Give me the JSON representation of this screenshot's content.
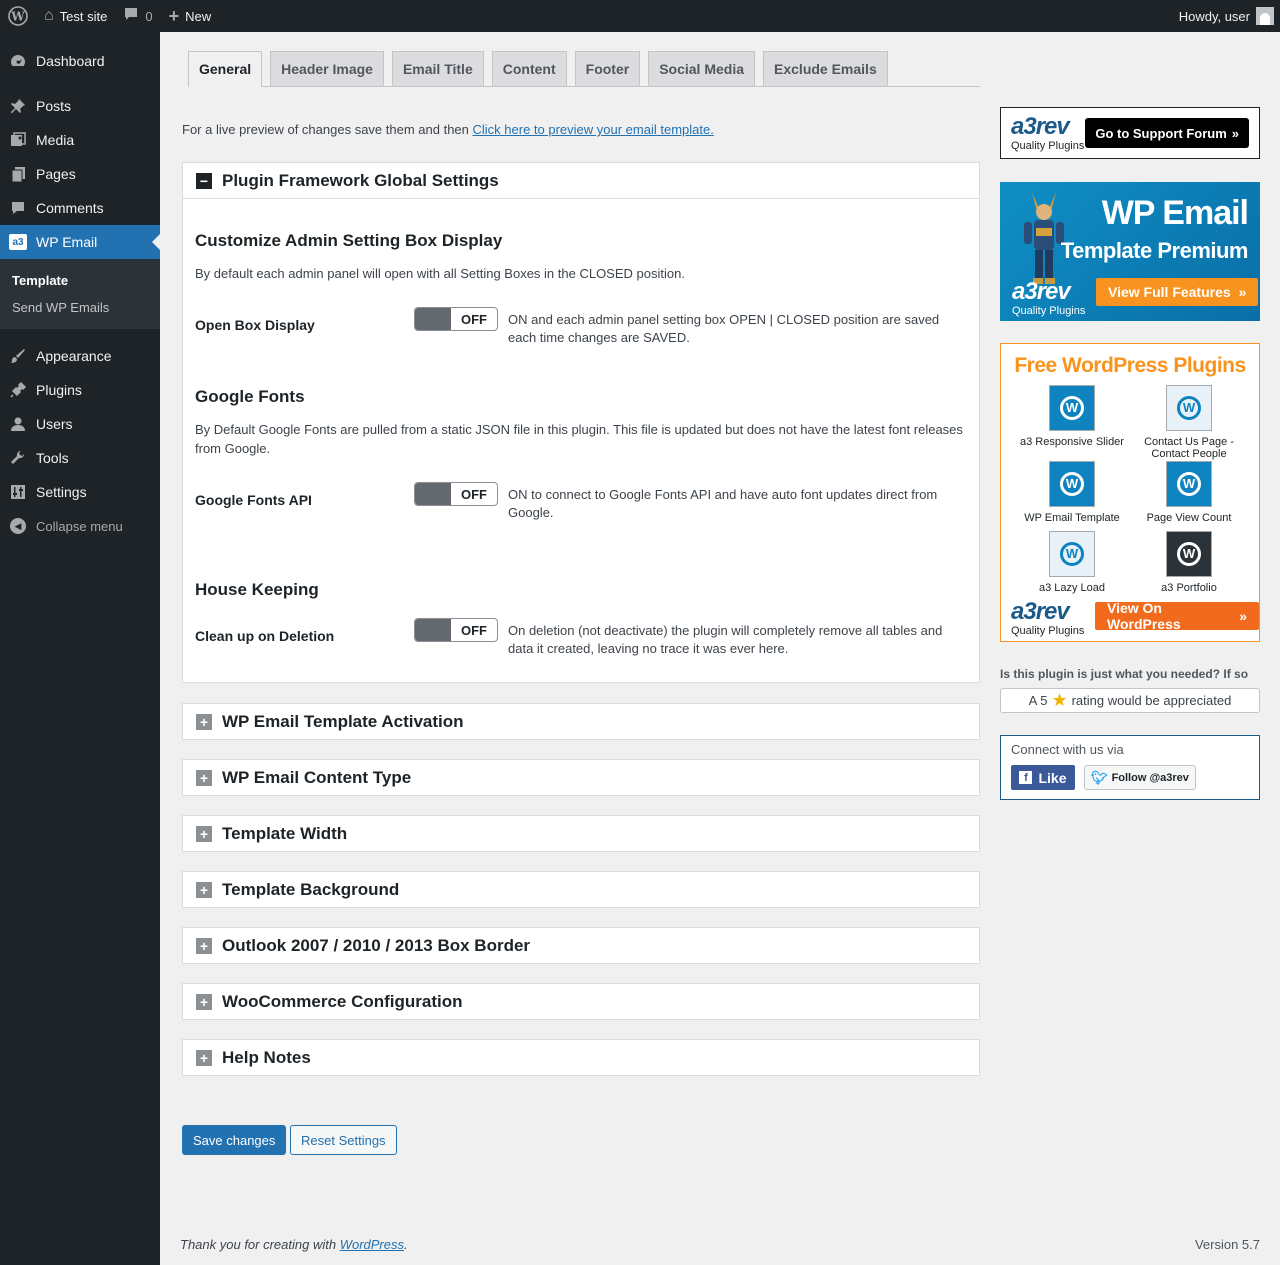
{
  "adminbar": {
    "site_name": "Test site",
    "comments_count": "0",
    "new_label": "New",
    "greeting": "Howdy, user"
  },
  "sidebar": {
    "items": [
      {
        "label": "Dashboard",
        "icon": "dashboard-icon"
      },
      {
        "label": "Posts",
        "icon": "pin-icon"
      },
      {
        "label": "Media",
        "icon": "media-icon"
      },
      {
        "label": "Pages",
        "icon": "pages-icon"
      },
      {
        "label": "Comments",
        "icon": "comment-icon"
      },
      {
        "label": "WP Email",
        "icon": "a3-icon"
      },
      {
        "label": "Appearance",
        "icon": "brush-icon"
      },
      {
        "label": "Plugins",
        "icon": "plug-icon"
      },
      {
        "label": "Users",
        "icon": "user-icon"
      },
      {
        "label": "Tools",
        "icon": "wrench-icon"
      },
      {
        "label": "Settings",
        "icon": "sliders-icon"
      }
    ],
    "submenu": [
      "Template",
      "Send WP Emails"
    ],
    "collapse_label": "Collapse menu"
  },
  "tabs": [
    "General",
    "Header Image",
    "Email Title",
    "Content",
    "Footer",
    "Social Media",
    "Exclude Emails"
  ],
  "preview": {
    "text": "For a live preview of changes save them and then",
    "link": "Click here to preview your email template."
  },
  "global_box": {
    "title": "Plugin Framework Global Settings",
    "sections": {
      "admin": {
        "title": "Customize Admin Setting Box Display",
        "desc": "By default each admin panel will open with all Setting Boxes in the CLOSED position.",
        "field_label": "Open Box Display",
        "switch": "OFF",
        "field_desc": "ON and each admin panel setting box OPEN | CLOSED position are saved each time changes are SAVED."
      },
      "fonts": {
        "title": "Google Fonts",
        "desc": "By Default Google Fonts are pulled from a static JSON file in this plugin. This file is updated but does not have the latest font releases from Google.",
        "field_label": "Google Fonts API",
        "switch": "OFF",
        "field_desc": "ON to connect to Google Fonts API and have auto font updates direct from Google."
      },
      "housekeeping": {
        "title": "House Keeping",
        "field_label": "Clean up on Deletion",
        "switch": "OFF",
        "field_desc": "On deletion (not deactivate) the plugin will completely remove all tables and data it created, leaving no trace it was ever here."
      }
    }
  },
  "collapsed_boxes": [
    "WP Email Template Activation",
    "WP Email Content Type",
    "Template Width",
    "Template Background",
    "Outlook 2007 / 2010 / 2013 Box Border",
    "WooCommerce Configuration",
    "Help Notes"
  ],
  "buttons": {
    "save": "Save changes",
    "reset": "Reset Settings"
  },
  "footer": {
    "thanks": "Thank you for creating with",
    "link": "WordPress",
    "version": "Version 5.7"
  },
  "right": {
    "a3_logo": "a3rev",
    "a3_tagline": "Quality Plugins",
    "support_btn": "Go to Support Forum",
    "premium_t1": "WP Email",
    "premium_t2": "Template Premium",
    "premium_btn": "View Full Features",
    "free_title": "Free WordPress Plugins",
    "plugins": [
      "a3 Responsive Slider",
      "Contact Us Page - Contact People",
      "WP Email Template",
      "Page View Count",
      "a3 Lazy Load",
      "a3 Portfolio"
    ],
    "view_wp_btn": "View On WordPress",
    "rate_question": "Is this plugin is just what you needed? If so",
    "rate_a": "A 5",
    "rate_b": "rating would be appreciated",
    "connect_title": "Connect with us via",
    "fb_label": "Like",
    "tw_label": "Follow @a3rev"
  },
  "colors": {
    "wp_blue": "#2271b1",
    "admin_dark": "#1d2327",
    "a3_orange": "#f7931e"
  }
}
